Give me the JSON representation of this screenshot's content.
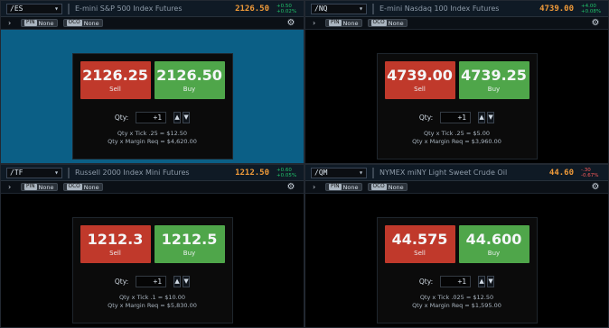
{
  "panels": [
    {
      "symbol": "/ES",
      "description": "E-mini S&P 500 Index Futures",
      "last": "2126.50",
      "change_top": "+0.50",
      "change_bottom": "+0.02%",
      "change_sign": "pos",
      "active": true,
      "pill_left_tag": "PIN",
      "pill_left_text": "None",
      "pill_right_tag": "OCO",
      "pill_right_text": "None",
      "sell_price_main": "2126.",
      "sell_price_strong": "25",
      "buy_price_main": "2126.",
      "buy_price_strong": "50",
      "sell_label": "Sell",
      "buy_label": "Buy",
      "qty_label": "Qty:",
      "qty_value": "+1",
      "info_line1": "Qty x Tick .25 = $12.50",
      "info_line2": "Qty x Margin Req = $4,620.00"
    },
    {
      "symbol": "/NQ",
      "description": "E-mini Nasdaq 100 Index Futures",
      "last": "4739.00",
      "change_top": "+4.00",
      "change_bottom": "+0.08%",
      "change_sign": "pos",
      "active": false,
      "pill_left_tag": "PIN",
      "pill_left_text": "None",
      "pill_right_tag": "OCO",
      "pill_right_text": "None",
      "sell_price_main": "4739.",
      "sell_price_strong": "00",
      "buy_price_main": "4739.",
      "buy_price_strong": "25",
      "sell_label": "Sell",
      "buy_label": "Buy",
      "qty_label": "Qty:",
      "qty_value": "+1",
      "info_line1": "Qty x Tick .25 = $5.00",
      "info_line2": "Qty x Margin Req = $3,960.00"
    },
    {
      "symbol": "/TF",
      "description": "Russell 2000 Index Mini Futures",
      "last": "1212.50",
      "change_top": "+0.60",
      "change_bottom": "+0.05%",
      "change_sign": "pos",
      "active": false,
      "pill_left_tag": "PIN",
      "pill_left_text": "None",
      "pill_right_tag": "OCO",
      "pill_right_text": "None",
      "sell_price_main": "121",
      "sell_price_strong": "2.3",
      "buy_price_main": "121",
      "buy_price_strong": "2.5",
      "sell_label": "Sell",
      "buy_label": "Buy",
      "qty_label": "Qty:",
      "qty_value": "+1",
      "info_line1": "Qty x Tick .1 = $10.00",
      "info_line2": "Qty x Margin Req = $5,830.00"
    },
    {
      "symbol": "/QM",
      "description": "NYMEX miNY Light Sweet Crude Oil",
      "last": "44.60",
      "change_top": "-.30",
      "change_bottom": "-0.67%",
      "change_sign": "neg",
      "active": false,
      "pill_left_tag": "PIN",
      "pill_left_text": "None",
      "pill_right_tag": "OCO",
      "pill_right_text": "None",
      "sell_price_main": "44.5",
      "sell_price_strong": "75",
      "buy_price_main": "44.6",
      "buy_price_strong": "00",
      "sell_label": "Sell",
      "buy_label": "Buy",
      "qty_label": "Qty:",
      "qty_value": "+1",
      "info_line1": "Qty x Tick .025 = $12.50",
      "info_line2": "Qty x Margin Req = $1,595.00"
    }
  ],
  "icons": {
    "dropdown": "▾",
    "chevron": "›",
    "gear": "⚙",
    "up": "▲",
    "down": "▼"
  }
}
